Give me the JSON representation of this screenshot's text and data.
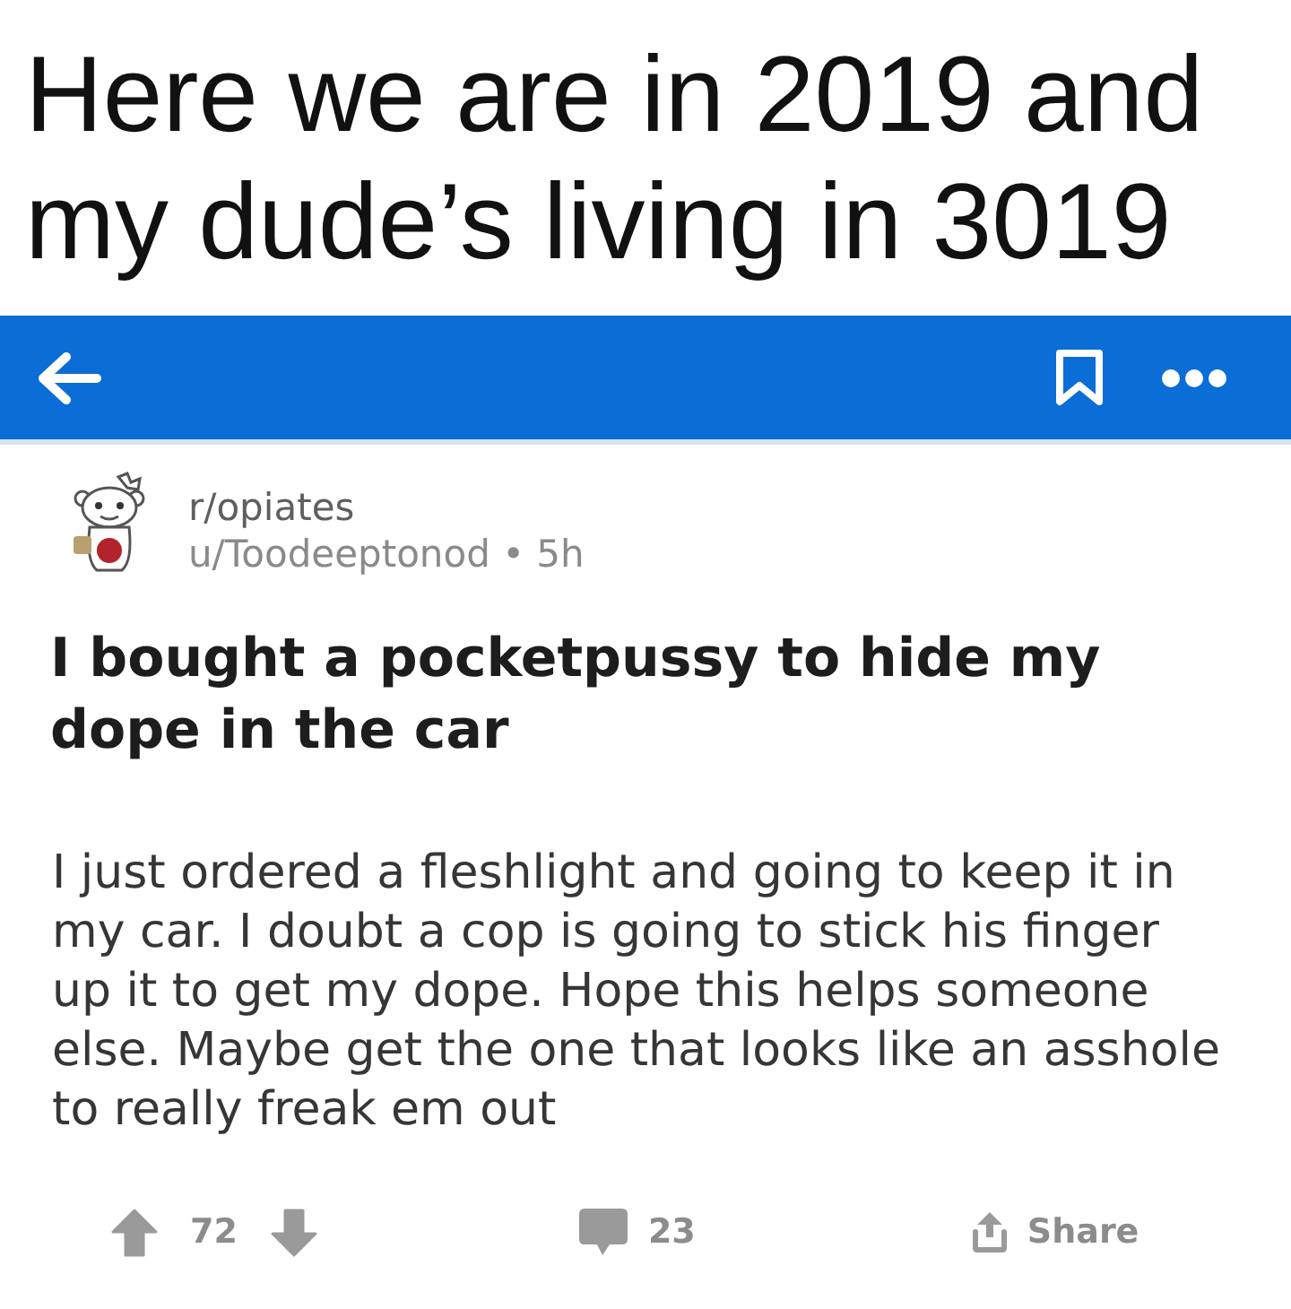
{
  "caption": "Here we are in 2019 and my dude’s living in 3019",
  "post": {
    "subreddit": "r/opiates",
    "byline": "u/Toodeeptonod • 5h",
    "title": "I bought a pocketpussy to hide my dope in the car",
    "body_lines": [
      "I just ordered a fleshlight and going to keep it in",
      "my car. I doubt a cop is going to stick his finger",
      "up it to get my dope. Hope this helps someone",
      "else. Maybe get the one that looks like an asshole",
      "to really freak em out"
    ],
    "actions": {
      "votes": "72",
      "comments": "23",
      "share": "Share"
    }
  }
}
